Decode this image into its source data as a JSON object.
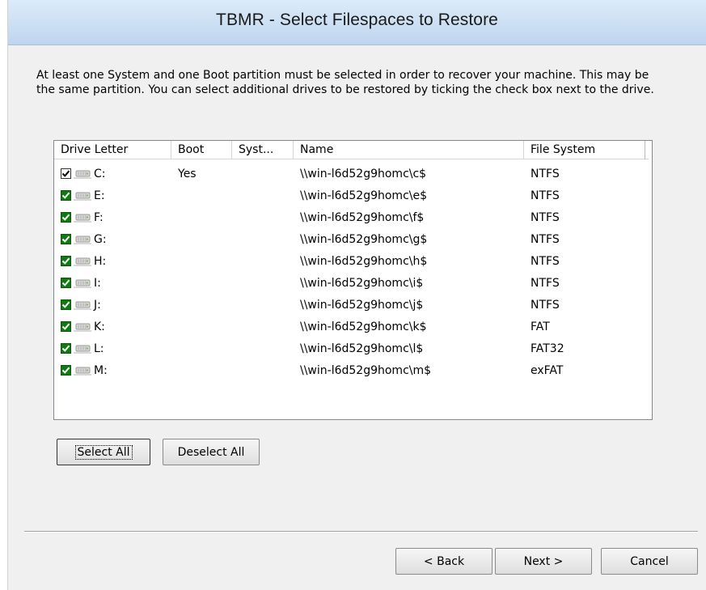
{
  "window": {
    "title": "TBMR - Select Filespaces to Restore"
  },
  "instructions": "At least one System and one Boot partition must be selected in order to recover your machine. This may be the same partition. You can select additional drives to be restored by ticking the check box next to the drive.",
  "listview": {
    "columns": [
      "Drive Letter",
      "Boot",
      "Syst...",
      "Name",
      "File System"
    ],
    "rows": [
      {
        "drive": "C:",
        "boot": "Yes",
        "system": "",
        "name": "\\\\win-l6d52g9homc\\c$",
        "fs": "NTFS",
        "checked": true,
        "check_style": "plain"
      },
      {
        "drive": "E:",
        "boot": "",
        "system": "",
        "name": "\\\\win-l6d52g9homc\\e$",
        "fs": "NTFS",
        "checked": true,
        "check_style": "green"
      },
      {
        "drive": "F:",
        "boot": "",
        "system": "",
        "name": "\\\\win-l6d52g9homc\\f$",
        "fs": "NTFS",
        "checked": true,
        "check_style": "green"
      },
      {
        "drive": "G:",
        "boot": "",
        "system": "",
        "name": "\\\\win-l6d52g9homc\\g$",
        "fs": "NTFS",
        "checked": true,
        "check_style": "green"
      },
      {
        "drive": "H:",
        "boot": "",
        "system": "",
        "name": "\\\\win-l6d52g9homc\\h$",
        "fs": "NTFS",
        "checked": true,
        "check_style": "green"
      },
      {
        "drive": "I:",
        "boot": "",
        "system": "",
        "name": "\\\\win-l6d52g9homc\\i$",
        "fs": "NTFS",
        "checked": true,
        "check_style": "green"
      },
      {
        "drive": "J:",
        "boot": "",
        "system": "",
        "name": "\\\\win-l6d52g9homc\\j$",
        "fs": "NTFS",
        "checked": true,
        "check_style": "green"
      },
      {
        "drive": "K:",
        "boot": "",
        "system": "",
        "name": "\\\\win-l6d52g9homc\\k$",
        "fs": "FAT",
        "checked": true,
        "check_style": "green"
      },
      {
        "drive": "L:",
        "boot": "",
        "system": "",
        "name": "\\\\win-l6d52g9homc\\l$",
        "fs": "FAT32",
        "checked": true,
        "check_style": "green"
      },
      {
        "drive": "M:",
        "boot": "",
        "system": "",
        "name": "\\\\win-l6d52g9homc\\m$",
        "fs": "exFAT",
        "checked": true,
        "check_style": "green"
      }
    ]
  },
  "buttons": {
    "select_all": "Select All",
    "deselect_all": "Deselect All",
    "back": "< Back",
    "next": "Next >",
    "cancel": "Cancel"
  },
  "colors": {
    "banner_top": "#dcebf9",
    "banner_bottom": "#bfd5ee",
    "check_green": "#0f7a0f",
    "window_bg": "#f0f0f0"
  },
  "icons": {
    "drive": "network-drive-icon",
    "check": "checkmark-icon"
  }
}
